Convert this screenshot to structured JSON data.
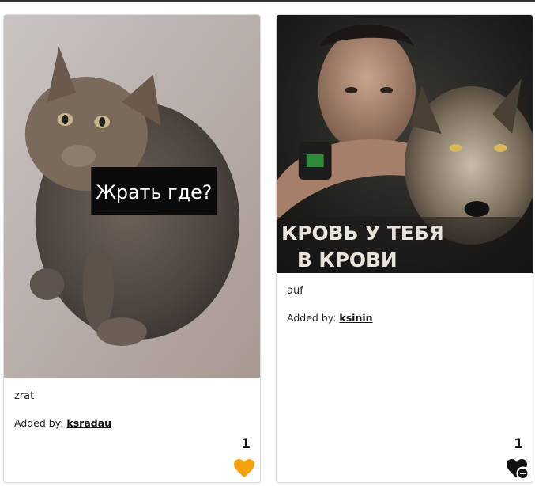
{
  "posts": [
    {
      "image_text": "Жрать где?",
      "caption": "zrat",
      "added_by_label": "Added by:",
      "author": "ksradau",
      "likes": "1",
      "heart_icon": "heart-icon",
      "heart_color": "#f5a00f"
    },
    {
      "image_text_line1": "КРОВЬ У ТЕБЯ",
      "image_text_line2": "В КРОВИ",
      "caption": "auf",
      "added_by_label": "Added by:",
      "author": "ksinin",
      "likes": "1",
      "heart_icon": "heart-minus-icon",
      "heart_color": "#111111"
    }
  ]
}
